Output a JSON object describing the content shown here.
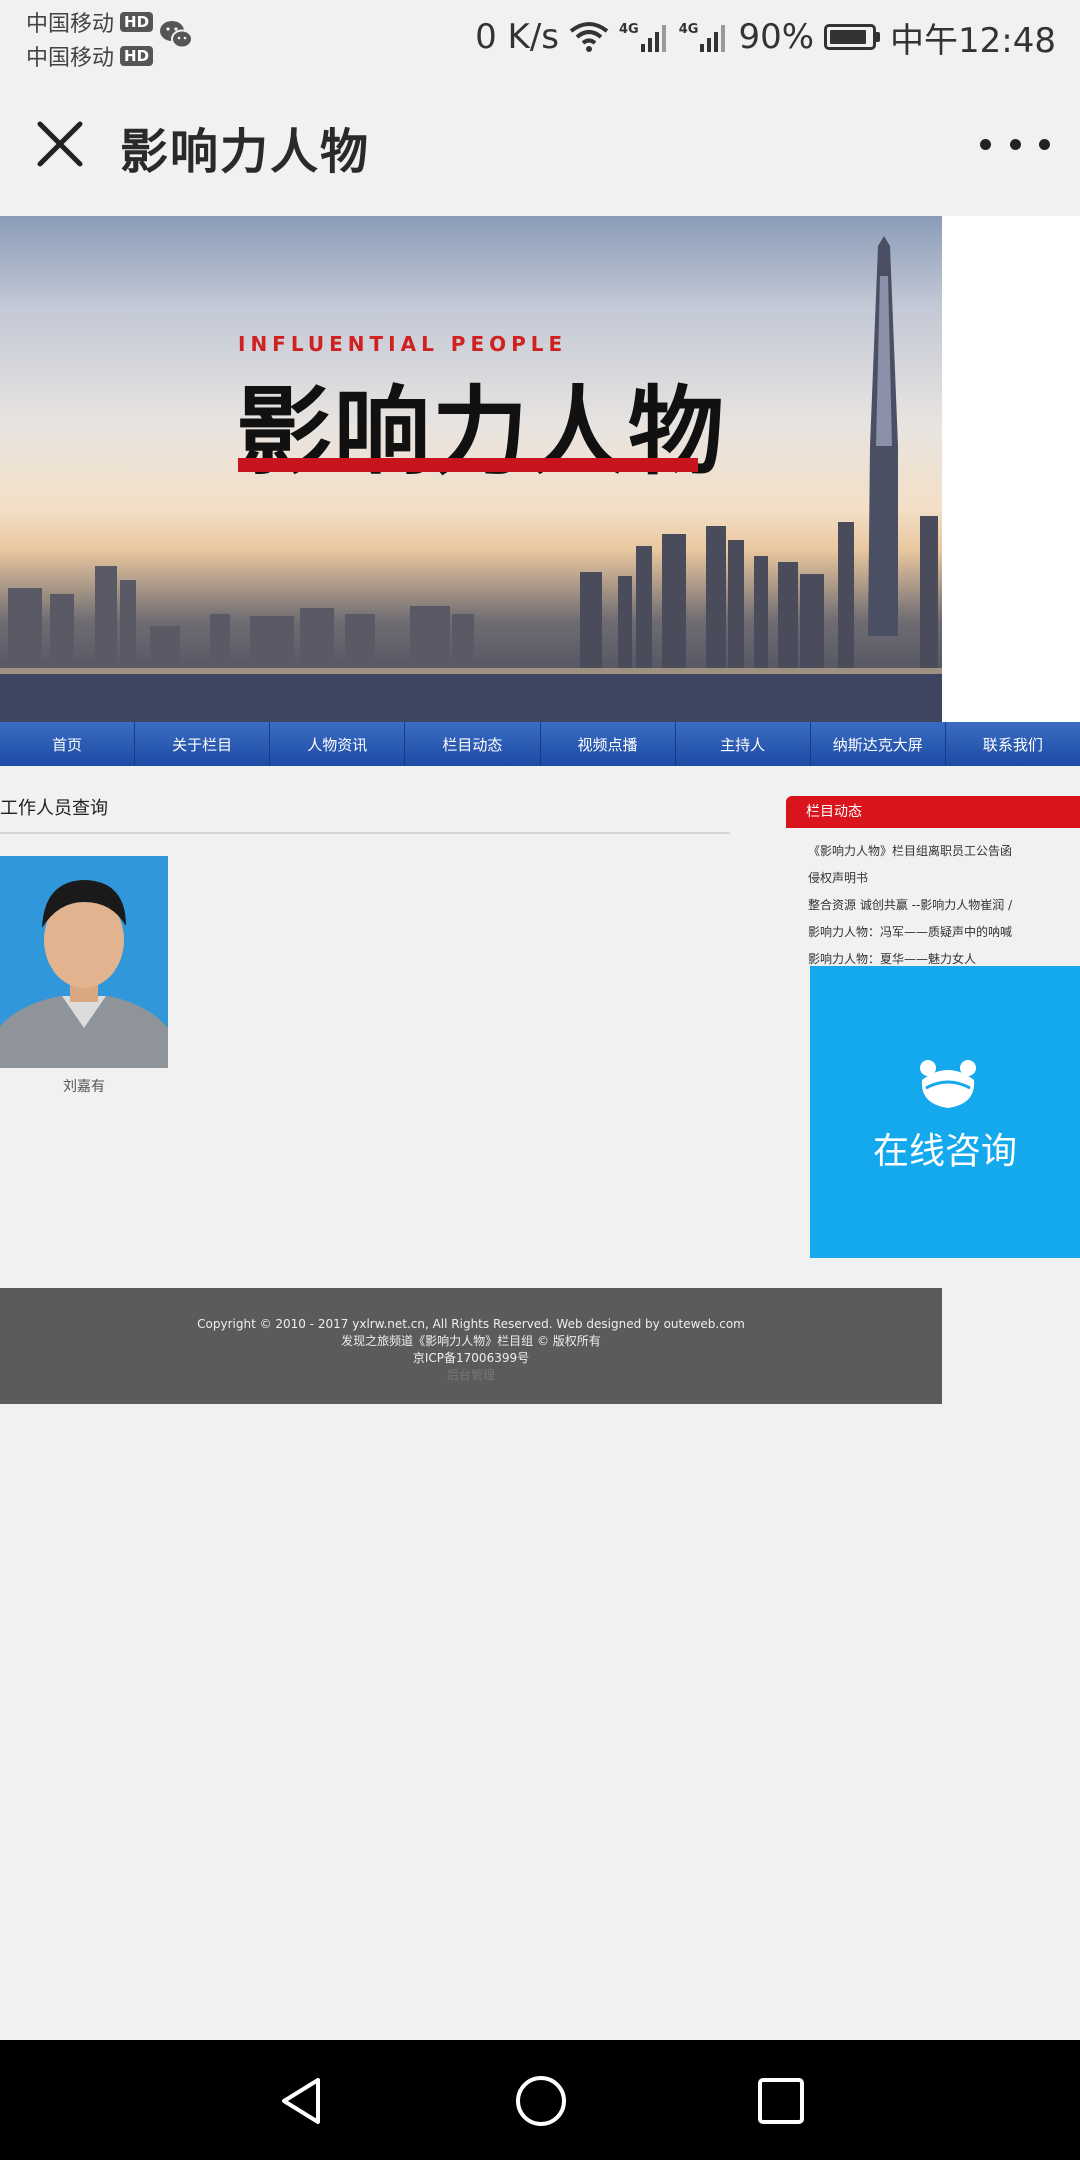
{
  "status_bar": {
    "carrier1": "中国移动",
    "carrier2": "中国移动",
    "hd_badge": "HD",
    "net_speed": "0 K/s",
    "signal_label": "4G",
    "battery_pct": "90%",
    "battery_level": 0.9,
    "time": "中午12:48"
  },
  "title_bar": {
    "title": "影响力人物"
  },
  "banner": {
    "logo_en": "INFLUENTIAL PEOPLE",
    "logo_cn": "影响力人物"
  },
  "nav": {
    "items": [
      "首页",
      "关于栏目",
      "人物资讯",
      "栏目动态",
      "视频点播",
      "主持人",
      "纳斯达克大屏",
      "联系我们"
    ]
  },
  "main": {
    "section_title": "工作人员查询",
    "person_name": "刘嘉有"
  },
  "sidebar": {
    "title": "栏目动态",
    "items": [
      "《影响力人物》栏目组离职员工公告函",
      "侵权声明书",
      "整合资源 诚创共赢 --影响力人物崔润 /",
      "影响力人物：冯军——质疑声中的呐喊",
      "影响力人物：夏华——魅力女人"
    ],
    "consult_label": "在线咨询"
  },
  "footer": {
    "copyright": "Copyright © 2010 - 2017 yxlrw.net.cn, All Rights Reserved. Web designed by outeweb.com",
    "line2": "发现之旅频道《影响力人物》栏目组 © 版权所有",
    "icp": "京ICP备17006399号",
    "line4": "后台管理"
  },
  "colors": {
    "nav_bg": "#2458b4",
    "sidebar_head": "#d9141c",
    "consult_bg": "#14a8ec",
    "footer_bg": "#5b5b5b"
  }
}
